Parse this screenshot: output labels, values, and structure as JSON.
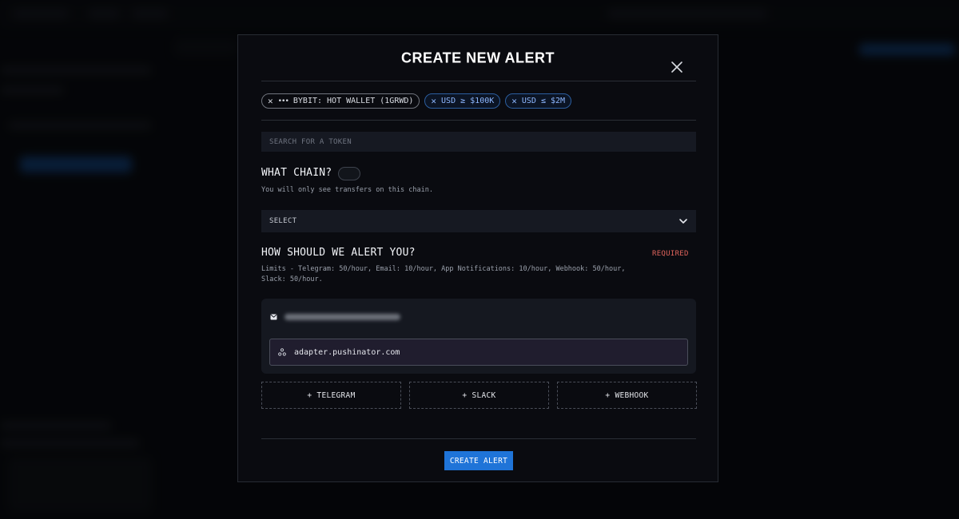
{
  "modal": {
    "title": "CREATE NEW ALERT",
    "filters": [
      {
        "label": "BYBIT: HOT WALLET (1GRWD)",
        "kind": "wallet"
      },
      {
        "label": "USD ≥ $100K",
        "kind": "usd"
      },
      {
        "label": "USD ≤ $2M",
        "kind": "usd"
      }
    ],
    "search": {
      "placeholder": "SEARCH FOR A TOKEN"
    },
    "chain": {
      "title": "WHAT CHAIN?",
      "helper": "You will only see transfers on this chain.",
      "select_label": "SELECT"
    },
    "alert": {
      "title": "HOW SHOULD WE ALERT YOU?",
      "required": "REQUIRED",
      "limits": "Limits - Telegram: 50/hour, Email: 10/hour, App Notifications: 10/hour, Webhook: 50/hour, Slack: 50/hour.",
      "webhook_value": "adapter.pushinator.com"
    },
    "add_buttons": [
      "+ TELEGRAM",
      "+ SLACK",
      "+ WEBHOOK"
    ],
    "submit_label": "CREATE ALERT"
  },
  "icons": {
    "close": "close-icon",
    "chip_remove": "x-icon",
    "chip_wallet": "more-dots-icon",
    "chevron": "chevron-down-icon",
    "email": "mail-icon",
    "webhook": "webhook-icon"
  },
  "colors": {
    "accent": "#1f74d8",
    "required": "#e0645c",
    "usd_chip": "#8db7ff"
  }
}
